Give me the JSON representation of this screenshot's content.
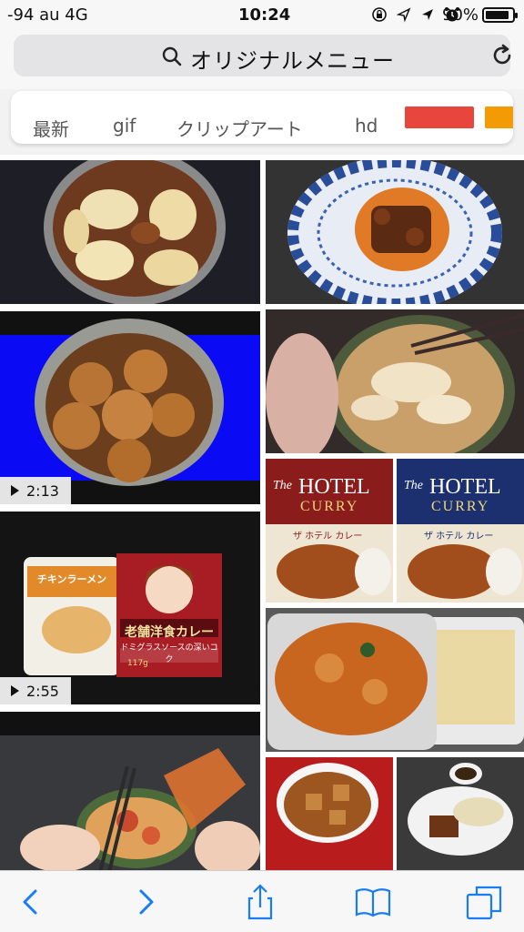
{
  "status_bar": {
    "carrier": "-94  au   4G",
    "time": "10:24",
    "battery_text": "90%",
    "battery_level": 0.9,
    "icons": [
      "orientation-lock-icon",
      "location-icon",
      "navigation-icon",
      "alarm-icon"
    ]
  },
  "url_bar": {
    "text": "オリジナルメニュー",
    "icons": [
      "search-icon",
      "reload-icon"
    ]
  },
  "filters": {
    "items": [
      "最新",
      "gif",
      "クリップアート",
      "hd"
    ],
    "swatches": [
      "#e8453c",
      "#f29b05"
    ]
  },
  "results": {
    "durations": [
      "2:13",
      "2:55"
    ],
    "hotel_curry": {
      "brand_line1": "The",
      "brand_line2": "HOTEL",
      "brand_line3": "CURRY",
      "subtitle": "ザ ホテル カレー"
    },
    "retro_curry": {
      "title": "老舗洋食カレー",
      "subtitle": "ドミグラスソースの深いコク",
      "weight": "117g"
    },
    "bag_label": "チキンラーメン"
  },
  "toolbar": {
    "icons": [
      "back-icon",
      "forward-icon",
      "share-icon",
      "bookmarks-icon",
      "tabs-icon"
    ],
    "accent": "#1a7cf5"
  }
}
